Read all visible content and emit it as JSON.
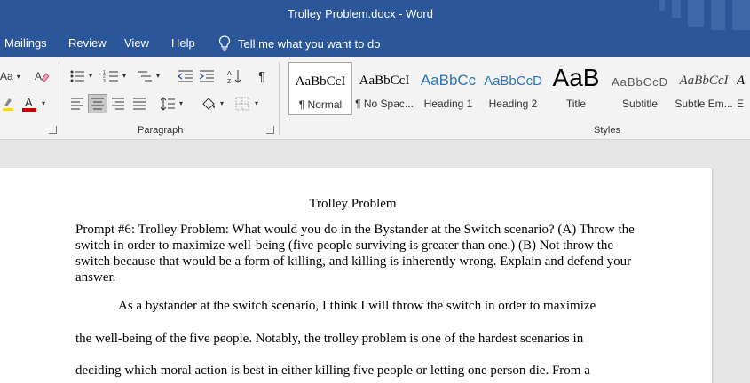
{
  "window": {
    "title": "Trolley Problem.docx  -  Word"
  },
  "menu": {
    "tabs": [
      "Mailings",
      "Review",
      "View",
      "Help"
    ],
    "tell_me": "Tell me what you want to do"
  },
  "ribbon": {
    "font_group": {
      "font_case_label": "Aa"
    },
    "paragraph_group": {
      "label": "Paragraph"
    },
    "styles_group": {
      "label": "Styles",
      "items": [
        {
          "preview": "AaBbCcI",
          "name": "¶ Normal"
        },
        {
          "preview": "AaBbCcI",
          "name": "¶ No Spac..."
        },
        {
          "preview": "AaBbCc",
          "name": "Heading 1"
        },
        {
          "preview": "AaBbCcD",
          "name": "Heading 2"
        },
        {
          "preview": "AaB",
          "name": "Title"
        },
        {
          "preview": "AaBbCcD",
          "name": "Subtitle"
        },
        {
          "preview": "AaBbCcI",
          "name": "Subtle Em..."
        },
        {
          "preview": "A",
          "name": "E"
        }
      ],
      "active_index": 0
    },
    "colors": {
      "font_color": "#c00000",
      "accent": "#2b579a",
      "heading_blue": "#2e74b5"
    }
  },
  "document": {
    "title": "Trolley Problem",
    "prompt_label": "Prompt #6: Trolley Problem:",
    "prompt_text": " What would you do in the Bystander at the Switch scenario? (A) Throw the switch in order to maximize well-being (five people surviving is greater than one.) (B) Not throw the switch because that would be a form of killing, and killing is inherently wrong. Explain and defend your answer.",
    "body_lines": [
      "As a bystander at the switch scenario, I think I will throw the switch in order to maximize",
      "the well-being of the five people. Notably, the trolley problem is one of the hardest scenarios in",
      "deciding which moral action is best in either killing five people or letting one person die. From a"
    ]
  }
}
